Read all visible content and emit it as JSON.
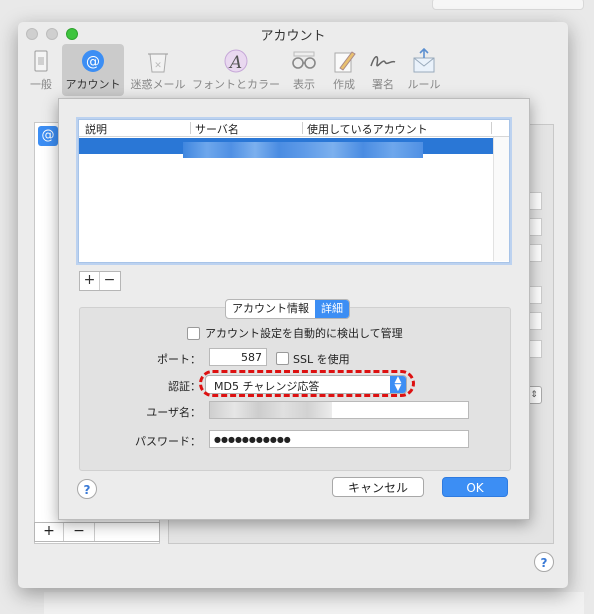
{
  "window": {
    "title": "アカウント"
  },
  "toolbar": {
    "items": [
      {
        "label": "一般",
        "icon": "switch-icon"
      },
      {
        "label": "アカウント",
        "icon": "at-icon"
      },
      {
        "label": "迷惑メール",
        "icon": "trash-icon"
      },
      {
        "label": "フォントとカラー",
        "icon": "font-icon"
      },
      {
        "label": "表示",
        "icon": "glasses-icon"
      },
      {
        "label": "作成",
        "icon": "pencil-icon"
      },
      {
        "label": "署名",
        "icon": "signature-icon"
      },
      {
        "label": "ルール",
        "icon": "rules-icon"
      }
    ]
  },
  "sheet": {
    "table": {
      "headers": [
        "説明",
        "サーバ名",
        "使用しているアカウント"
      ]
    },
    "add_label": "+",
    "remove_label": "−",
    "tabs": [
      {
        "label": "アカウント情報"
      },
      {
        "label": "詳細"
      }
    ],
    "auto_detect_label": "アカウント設定を自動的に検出して管理",
    "port_label": "ポート：",
    "port_value": "587",
    "ssl_label": "SSL を使用",
    "auth_label": "認証：",
    "auth_value": "MD5 チャレンジ応答",
    "username_label": "ユーザ名：",
    "password_label": "パスワード：",
    "password_value": "●●●●●●●●●●●",
    "help_label": "?",
    "cancel_label": "キャンセル",
    "ok_label": "OK"
  },
  "window_bottom": {
    "add_label": "+",
    "remove_label": "−",
    "help_label": "?"
  },
  "colors": {
    "accent": "#3c8ef4",
    "selection": "#2a77d6",
    "highlight_ring": "#dd1111"
  }
}
